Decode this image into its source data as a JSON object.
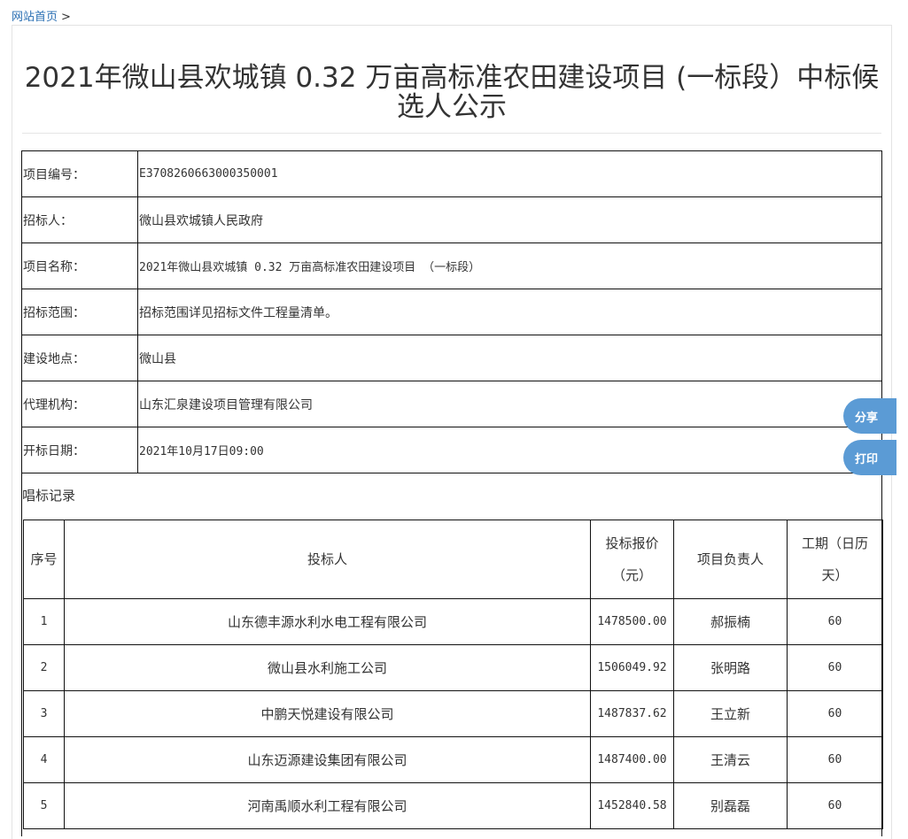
{
  "breadcrumb": {
    "home": "网站首页",
    "separator": ">"
  },
  "page_title": "2021年微山县欢城镇 0.32 万亩高标准农田建设项目 (一标段）中标候选人公示",
  "info_rows": [
    {
      "label": "项目编号：",
      "value": "E3708260663000350001"
    },
    {
      "label": "招标人：",
      "value": "微山县欢城镇人民政府"
    },
    {
      "label": "项目名称：",
      "value": "2021年微山县欢城镇 0.32 万亩高标准农田建设项目 （一标段）"
    },
    {
      "label": "招标范围：",
      "value": "招标范围详见招标文件工程量清单。"
    },
    {
      "label": "建设地点：",
      "value": "微山县"
    },
    {
      "label": "代理机构：",
      "value": "山东汇泉建设项目管理有限公司"
    },
    {
      "label": "开标日期：",
      "value": "2021年10月17日09:00"
    }
  ],
  "record_heading": "唱标记录",
  "bids_table": {
    "headers": {
      "no": "序号",
      "bidder": "投标人",
      "price": "投标报价（元）",
      "manager": "项目负责人",
      "duration": "工期（日历天）"
    },
    "rows": [
      {
        "no": "1",
        "bidder": "山东德丰源水利水电工程有限公司",
        "price": "1478500.00",
        "manager": "郝振楠",
        "duration": "60"
      },
      {
        "no": "2",
        "bidder": "微山县水利施工公司",
        "price": "1506049.92",
        "manager": "张明路",
        "duration": "60"
      },
      {
        "no": "3",
        "bidder": "中鹏天悦建设有限公司",
        "price": "1487837.62",
        "manager": "王立新",
        "duration": "60"
      },
      {
        "no": "4",
        "bidder": "山东迈源建设集团有限公司",
        "price": "1487400.00",
        "manager": "王清云",
        "duration": "60"
      },
      {
        "no": "5",
        "bidder": "河南禹顺水利工程有限公司",
        "price": "1452840.58",
        "manager": "别磊磊",
        "duration": "60"
      }
    ]
  },
  "float_buttons": {
    "share": "分享",
    "print": "打印"
  },
  "colors": {
    "link": "#2a6fb3",
    "float_button": "#5b9bd5"
  }
}
